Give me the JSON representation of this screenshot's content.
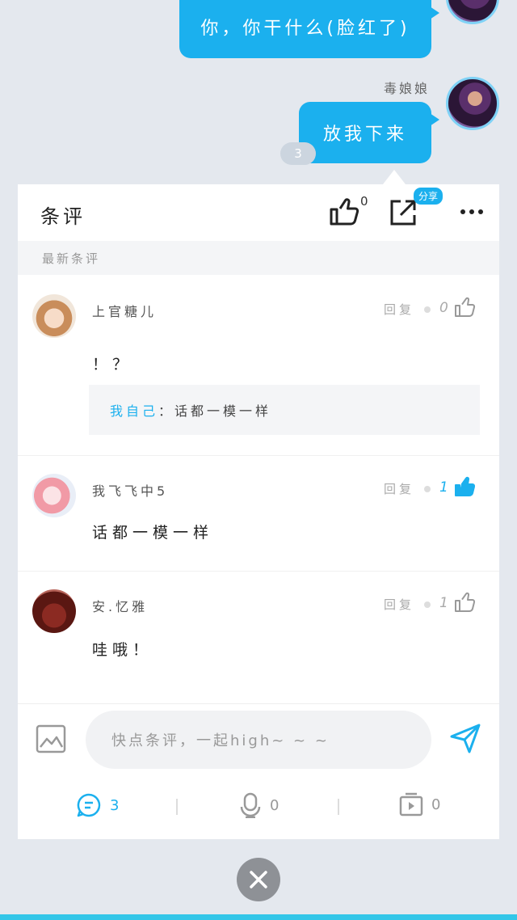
{
  "chat": {
    "messages": [
      {
        "text": "你，你干什么(脸红了)"
      },
      {
        "sender": "毒娘娘",
        "text": "放我下来"
      }
    ],
    "unread_count": "3"
  },
  "panel": {
    "title": "条评",
    "like_count": "0",
    "share_badge": "分享",
    "section_label": "最新条评",
    "comments": [
      {
        "user": "上官糖儿",
        "reply_label": "回复",
        "likes": "0",
        "liked": false,
        "text": "！？",
        "quote": {
          "who": "我自己",
          "sep": "：",
          "text": "话都一模一样"
        }
      },
      {
        "user": "我飞飞中5",
        "reply_label": "回复",
        "likes": "1",
        "liked": true,
        "text": "话都一模一样"
      },
      {
        "user": "安.忆雅",
        "reply_label": "回复",
        "likes": "1",
        "liked": false,
        "text": "哇哦！"
      }
    ],
    "input_placeholder": "快点条评，一起high~ ~ ~",
    "tabs": [
      {
        "icon": "comment-icon",
        "count": "3",
        "active": true
      },
      {
        "icon": "microphone-icon",
        "count": "0",
        "active": false
      },
      {
        "icon": "video-icon",
        "count": "0",
        "active": false
      }
    ]
  },
  "colors": {
    "accent": "#1bb0ee",
    "background": "#e4e8ee"
  }
}
